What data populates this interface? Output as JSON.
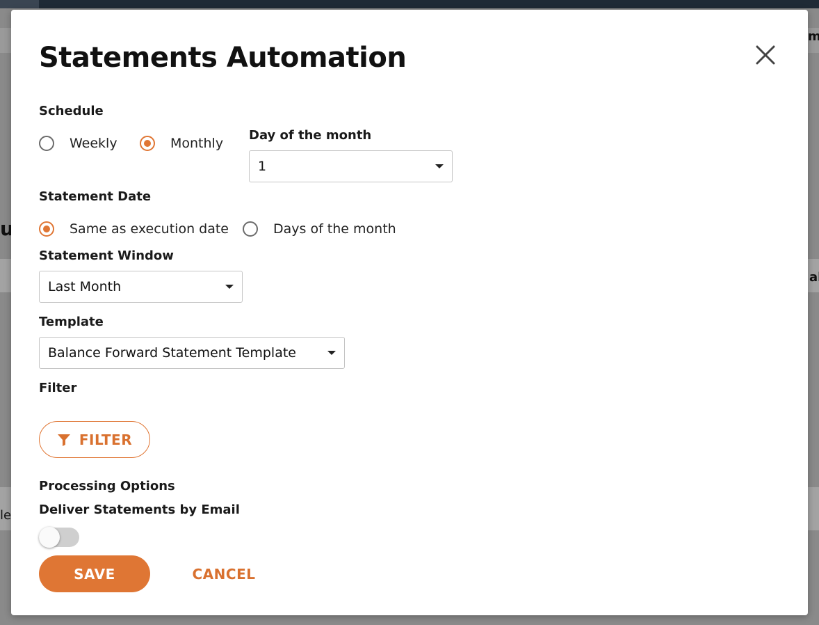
{
  "background": {
    "fragments": [
      "m",
      "ul",
      "al",
      "le"
    ]
  },
  "modal": {
    "title": "Statements Automation",
    "close_icon": "close-icon"
  },
  "schedule": {
    "label": "Schedule",
    "options": [
      {
        "label": "Weekly",
        "selected": false
      },
      {
        "label": "Monthly",
        "selected": true
      }
    ],
    "day_of_month": {
      "label": "Day of the month",
      "value": "1"
    }
  },
  "statement_date": {
    "label": "Statement Date",
    "options": [
      {
        "label": "Same as execution date",
        "selected": true
      },
      {
        "label": "Days of the month",
        "selected": false
      }
    ]
  },
  "statement_window": {
    "label": "Statement Window",
    "value": "Last Month"
  },
  "template": {
    "label": "Template",
    "value": "Balance Forward Statement Template"
  },
  "filter": {
    "label": "Filter",
    "button_label": "FILTER",
    "icon": "filter-icon"
  },
  "processing": {
    "label": "Processing Options",
    "email_label": "Deliver Statements by Email",
    "email_enabled": false
  },
  "actions": {
    "save_label": "SAVE",
    "cancel_label": "CANCEL"
  },
  "colors": {
    "accent": "#df7634",
    "overlay": "#8a8a8a",
    "text": "#111111"
  }
}
